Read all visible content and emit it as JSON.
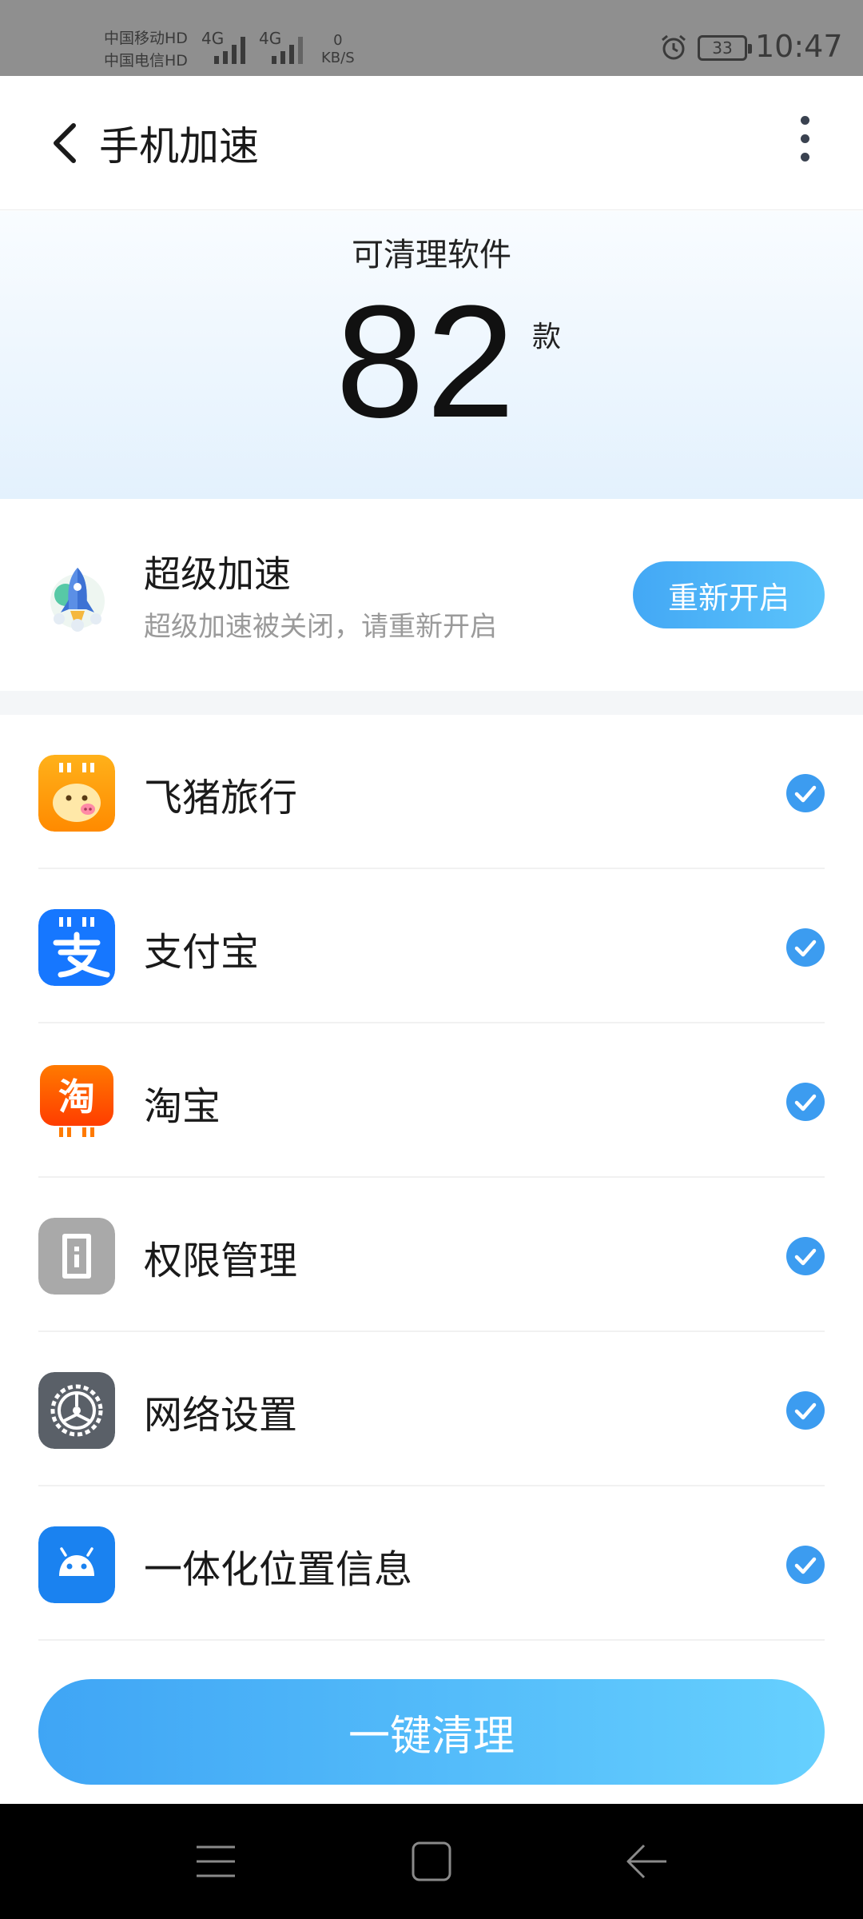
{
  "status_bar": {
    "carrier_1": "中国移动HD",
    "carrier_2": "中国电信HD",
    "network_1": "4G",
    "network_2": "4G",
    "speed_value": "0",
    "speed_unit": "KB/S",
    "battery": "33",
    "time": "10:47"
  },
  "header": {
    "title": "手机加速"
  },
  "summary": {
    "label": "可清理软件",
    "count": "82",
    "unit": "款"
  },
  "super_boost": {
    "title": "超级加速",
    "subtitle": "超级加速被关闭，请重新开启",
    "button_label": "重新开启"
  },
  "apps": [
    {
      "name": "飞猪旅行",
      "icon": "fliggy-icon",
      "checked": true
    },
    {
      "name": "支付宝",
      "icon": "alipay-icon",
      "checked": true
    },
    {
      "name": "淘宝",
      "icon": "taobao-icon",
      "checked": true
    },
    {
      "name": "权限管理",
      "icon": "permission-icon",
      "checked": true
    },
    {
      "name": "网络设置",
      "icon": "settings-gear-icon",
      "checked": true
    },
    {
      "name": "一体化位置信息",
      "icon": "android-icon",
      "checked": true
    }
  ],
  "clean_button": {
    "label": "一键清理"
  },
  "colors": {
    "accent": "#43a8f5",
    "check": "#3c9cf0"
  }
}
